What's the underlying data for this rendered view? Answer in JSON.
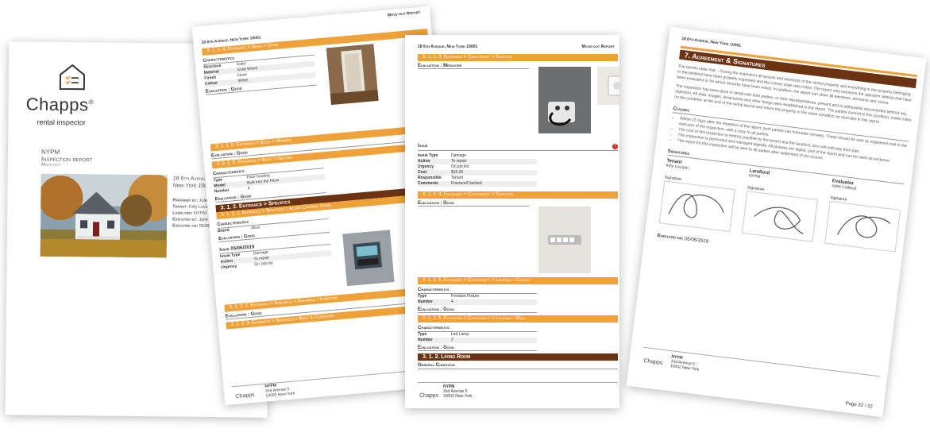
{
  "cover": {
    "brand": "Chapps",
    "brand_mark": "®",
    "brand_sub": "rental inspector",
    "company": "NYPM",
    "doc_title": "Inspection report",
    "doc_type": "Move-out",
    "address1": "18 6th Avenue",
    "address2": "New York 10001",
    "prepared_label": "Prepared by:",
    "prepared_value": "Julie C",
    "tenant_label": "Tenant:",
    "tenant_value": "Kitty Lovci",
    "landlord_label": "Landlord:",
    "landlord_value": "NYPM",
    "executed_by_label": "Executed by:",
    "executed_by_value": "Julie C",
    "executed_on_label": "Executed on:",
    "executed_on_value": "05/06/2"
  },
  "page2": {
    "header_address": "18 6th Avenue, New York 10001",
    "header_report": "Move-out Report",
    "bar1": "3. 1. 1. 4. Entrance > Basic > Door",
    "characteristics": "Characteristics",
    "rows1": [
      {
        "k": "Structure",
        "v": "Solid"
      },
      {
        "k": "Material",
        "v": "Solid Wood"
      },
      {
        "k": "Finish",
        "v": "None"
      },
      {
        "k": "Colour",
        "v": "White"
      }
    ],
    "eval_good": "Evaluation : Good",
    "bar2": "3. 1. 1. 5. Entrance > Basic > Window",
    "bar3": "3. 1. 1. 6. Entrance > Basic > Heating",
    "rows2": [
      {
        "k": "Type",
        "v": "Floor heating"
      },
      {
        "k": "Model",
        "v": "Built into the Floor"
      },
      {
        "k": "Number",
        "v": "4"
      }
    ],
    "section": "3. 1. 2. Entrance > Specifics",
    "bar4": "3. 1. 2. 1. Entrance > Specifics > Alarm Control Panel",
    "brand_label": "Brand",
    "brand_value": "Abus",
    "issue_title": "Issue 05/06/2019",
    "issue_rows": [
      {
        "k": "Issue Type",
        "v": "Damage"
      },
      {
        "k": "Action",
        "v": "To repair"
      },
      {
        "k": "Urgency",
        "v": "On Job list"
      }
    ],
    "bar5": "3. 1. 2. 2. Entrance > Specifics > Doorbell / Intercom",
    "bar6": "3. 1. 2. 3. Entrance > Specifics > Built In Cupboard",
    "footer_company": "NYPM",
    "footer_addr1": "2nd Avenue 5",
    "footer_addr2": "10002 New-York"
  },
  "page3": {
    "header_address": "18 6th Avenue, New York 10001",
    "header_report": "Move-out Report",
    "bar1": "3. 1. 1. 3. Entrance > Conformity > Sockets",
    "eval_mediocre": "Evaluation : Mediocre",
    "issue_label": "Issue",
    "issue_rows": [
      {
        "k": "Issue Type",
        "v": "Damage"
      },
      {
        "k": "Action",
        "v": "To repair"
      },
      {
        "k": "Urgency",
        "v": "On job list"
      },
      {
        "k": "Cost",
        "v": "$15.00"
      },
      {
        "k": "Responsible",
        "v": "Tenant"
      },
      {
        "k": "Comments",
        "v": "Fracture/Cracked"
      }
    ],
    "bar2": "3. 1. 1. 4. Entrance > Conformity > Switches",
    "eval_good": "Evaluation : Good",
    "bar3": "3. 1. 1. 5. Entrance > Conformity > Lighting - Ceiling",
    "characteristics": "Characteristics",
    "rows_ceiling": [
      {
        "k": "Type",
        "v": "Pendant Fixture"
      },
      {
        "k": "Number",
        "v": "4"
      }
    ],
    "bar4": "3. 1. 1. 6. Entrance > Conformity > Lighting - Wall",
    "rows_wall": [
      {
        "k": "Type",
        "v": "Led Lamp"
      },
      {
        "k": "Number",
        "v": "2"
      }
    ],
    "section": "3. 1. 2. Living Room",
    "general": "General Condition",
    "footer_company": "NYPM",
    "footer_addr1": "2nd Avenue 5",
    "footer_addr2": "10002 New-York"
  },
  "page4": {
    "header_address": "18 6th Avenue, New York 10001",
    "header_report": "Move-out Report",
    "section": "7. Agreement & Signatures",
    "para1": "The parties state that: - During the inspection all spaces and elements of the rented property and everything in the property belonging to the landlord have been properly inspected and the correct state was noted. The report only mentions the apparent defects that have been evaluated or for which remarks have been noted. In addition, the report can show all elements, elements and rooms.",
    "para2": "The inspection has been done in detail with both parties, or their representatives, present and is adequately documented without any objection. All data, images, dimensions and other things were established in the report. The parties commit to the condition, make notes on the condition at the end of the rental period and return the property in the same condition as recorded in this report.",
    "clauses": "Clauses",
    "clause1": "Within 15 days after the reception of the report, both parties can formulate remarks. These should be sent by registered mail to the executor of the inspection, with a copy to all parties.",
    "clause2": "The cost of this inspection is entirely payable by the tenant and the landlord, who will both pay their part.",
    "clause3": "This inspection is performed and managed digitally. All pictures are digital, part of the report and can be used as evidence.",
    "clause4": "The report for this inspection will be sent to all parties after settlement of the invoice.",
    "signatures": "Signatures",
    "tenant_label": "Tenant",
    "tenant_name": "Kitty Lovcpin",
    "landlord_label": "Landlord",
    "landlord_name": "NYPM",
    "evaluator_label": "Evaluator",
    "evaluator_name": "Juliet Colbeck",
    "signature_label": "Signature",
    "executed_label": "Executed on:",
    "executed_value": "05/06/2019",
    "footer_company": "NYPM",
    "footer_addr1": "2nd Avenue 5",
    "footer_addr2": "10002 New-York",
    "page_num": "Page 32 / 32"
  },
  "colors": {
    "orange": "#f0a23a",
    "brown": "#6b3312",
    "issue_red": "#d62b1e"
  }
}
